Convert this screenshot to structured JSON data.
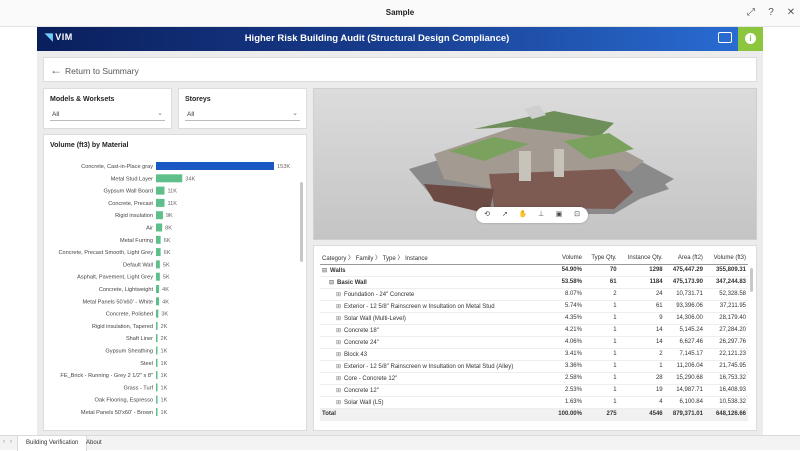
{
  "window": {
    "title": "Sample"
  },
  "banner": {
    "logo": "VIM",
    "title": "Higher Risk Building Audit (Structural Design Compliance)"
  },
  "return_label": "Return to Summary",
  "slicers": {
    "models": {
      "title": "Models & Worksets",
      "value": "All"
    },
    "storeys": {
      "title": "Storeys",
      "value": "All"
    }
  },
  "colors": {
    "bar": "#1a58c4",
    "bar_green": "#5fbf8a",
    "accent_green": "#8cc63f"
  },
  "chart_data": {
    "type": "bar",
    "title": "Volume (ft3) by Material",
    "categories": [
      "Concrete, Cast-in-Place gray",
      "Metal Stud Layer",
      "Gypsum Wall Board",
      "Concrete, Precast",
      "Rigid insulation",
      "Air",
      "Metal Furring",
      "Concrete, Precast Smooth, Light Grey",
      "Default Wall",
      "Asphalt, Pavement, Light Grey",
      "Concrete, Lightweight",
      "Metal Panels 50'x60' - White",
      "Concrete, Polished",
      "Rigid insulation, Tapered",
      "Shaft Liner",
      "Gypsum Sheathing",
      "Steel",
      "FE_Brick - Running - Grey 2 1/2\" x 8\"",
      "Grass - Turf",
      "Oak Flooring, Espresso",
      "Metal Panels 50'x60' - Brown"
    ],
    "values": [
      153,
      34,
      11,
      11,
      9,
      8,
      6,
      6,
      5,
      5,
      4,
      4,
      3,
      2,
      2,
      1,
      1,
      1,
      1,
      1,
      1
    ],
    "labels": [
      "153K",
      "34K",
      "11K",
      "11K",
      "9K",
      "8K",
      "6K",
      "6K",
      "5K",
      "5K",
      "4K",
      "4K",
      "3K",
      "2K",
      "2K",
      "1K",
      "1K",
      "1K",
      "1K",
      "1K",
      "1K"
    ],
    "units": "K"
  },
  "table": {
    "headers": {
      "hier": [
        "Category",
        "Family",
        "Type",
        "Instance"
      ],
      "volume": "Volume",
      "type_qty": "Type Qty.",
      "inst_qty": "Instance Qty.",
      "area": "Area (ft2)",
      "vol_ft3": "Volume (ft3)"
    },
    "rows": [
      {
        "name": "Walls",
        "level": 0,
        "toggle": "⊟",
        "volume": "54.90%",
        "type_qty": "70",
        "inst_qty": "1298",
        "area": "475,447.29",
        "vol": "355,809.31",
        "bold": true
      },
      {
        "name": "Basic Wall",
        "level": 1,
        "toggle": "⊟",
        "volume": "53.58%",
        "type_qty": "61",
        "inst_qty": "1184",
        "area": "475,173.90",
        "vol": "347,244.83",
        "bold": true
      },
      {
        "name": "Foundation - 24\" Concrete",
        "level": 2,
        "toggle": "⊞",
        "volume": "8.07%",
        "type_qty": "2",
        "inst_qty": "24",
        "area": "10,731.71",
        "vol": "52,328.58"
      },
      {
        "name": "Exterior - 12 5/8\" Rainscreen w Insultation on Metal Stud",
        "level": 2,
        "toggle": "⊞",
        "volume": "5.74%",
        "type_qty": "1",
        "inst_qty": "61",
        "area": "93,396.06",
        "vol": "37,211.95"
      },
      {
        "name": "Solar Wall (Multi-Level)",
        "level": 2,
        "toggle": "⊞",
        "volume": "4.35%",
        "type_qty": "1",
        "inst_qty": "9",
        "area": "14,306.00",
        "vol": "28,179.40"
      },
      {
        "name": "Concrete 18\"",
        "level": 2,
        "toggle": "⊞",
        "volume": "4.21%",
        "type_qty": "1",
        "inst_qty": "14",
        "area": "5,145.24",
        "vol": "27,284.20"
      },
      {
        "name": "Concrete 24\"",
        "level": 2,
        "toggle": "⊞",
        "volume": "4.06%",
        "type_qty": "1",
        "inst_qty": "14",
        "area": "6,627.46",
        "vol": "26,297.76"
      },
      {
        "name": "Block 43",
        "level": 2,
        "toggle": "⊞",
        "volume": "3.41%",
        "type_qty": "1",
        "inst_qty": "2",
        "area": "7,145.17",
        "vol": "22,121.23"
      },
      {
        "name": "Exterior - 12 5/8\" Rainscreen w Insultation on Metal Stud (Alley)",
        "level": 2,
        "toggle": "⊞",
        "volume": "3.36%",
        "type_qty": "1",
        "inst_qty": "1",
        "area": "11,206.04",
        "vol": "21,745.95"
      },
      {
        "name": "Core - Concrete 12\"",
        "level": 2,
        "toggle": "⊞",
        "volume": "2.58%",
        "type_qty": "1",
        "inst_qty": "28",
        "area": "15,290.68",
        "vol": "16,753.32"
      },
      {
        "name": "Concrete 12\"",
        "level": 2,
        "toggle": "⊞",
        "volume": "2.53%",
        "type_qty": "1",
        "inst_qty": "19",
        "area": "14,987.71",
        "vol": "16,408.93"
      },
      {
        "name": "Solar Wall (L5)",
        "level": 2,
        "toggle": "⊞",
        "volume": "1.63%",
        "type_qty": "1",
        "inst_qty": "4",
        "area": "6,100.84",
        "vol": "10,538.32"
      }
    ],
    "total": {
      "name": "Total",
      "volume": "100.00%",
      "type_qty": "275",
      "inst_qty": "4546",
      "area": "879,371.01",
      "vol": "648,126.66"
    }
  },
  "tabs": [
    {
      "label": "Building Verification",
      "active": true
    },
    {
      "label": "About",
      "active": false
    }
  ]
}
